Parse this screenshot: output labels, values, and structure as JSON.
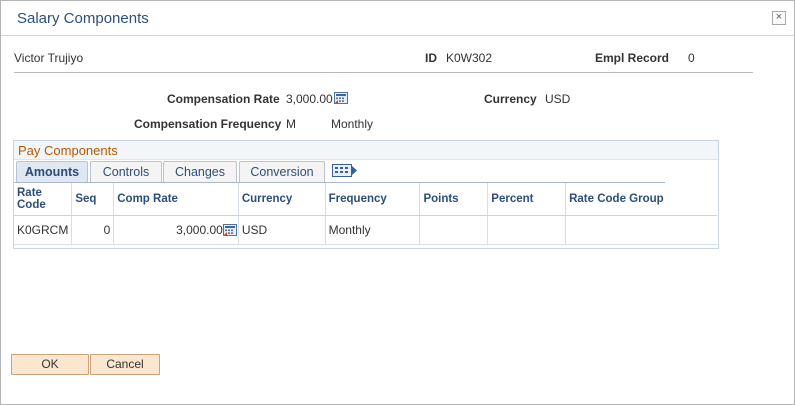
{
  "window": {
    "title": "Salary Components",
    "close_glyph": "×"
  },
  "employee": {
    "name": "Victor Trujiyo",
    "id_label": "ID",
    "id_value": "K0W302",
    "empl_record_label": "Empl Record",
    "empl_record_value": "0"
  },
  "compensation": {
    "rate_label": "Compensation Rate",
    "rate_value": "3,000.00",
    "currency_label": "Currency",
    "currency_value": "USD",
    "frequency_label": "Compensation Frequency",
    "frequency_code": "M",
    "frequency_text": "Monthly"
  },
  "pay_components": {
    "title": "Pay Components",
    "tabs": [
      {
        "label": "Amounts",
        "active": true
      },
      {
        "label": "Controls",
        "active": false
      },
      {
        "label": "Changes",
        "active": false
      },
      {
        "label": "Conversion",
        "active": false
      }
    ],
    "columns": [
      "Rate Code",
      "Seq",
      "Comp Rate",
      "Currency",
      "Frequency",
      "Points",
      "Percent",
      "Rate Code Group"
    ],
    "rows": [
      {
        "rate_code": "K0GRCM",
        "seq": "0",
        "comp_rate": "3,000.00",
        "currency": "USD",
        "frequency": "Monthly",
        "points": "",
        "percent": "",
        "rate_code_group": ""
      }
    ]
  },
  "buttons": {
    "ok": "OK",
    "cancel": "Cancel"
  },
  "icons": {
    "calculator": "calculator-icon",
    "show_all_columns": "show-all-columns-icon",
    "close": "close-icon"
  },
  "colors": {
    "accent": "#2e4f7a",
    "grid_title": "#b45a00",
    "button_bg": "#fbe6cf"
  }
}
